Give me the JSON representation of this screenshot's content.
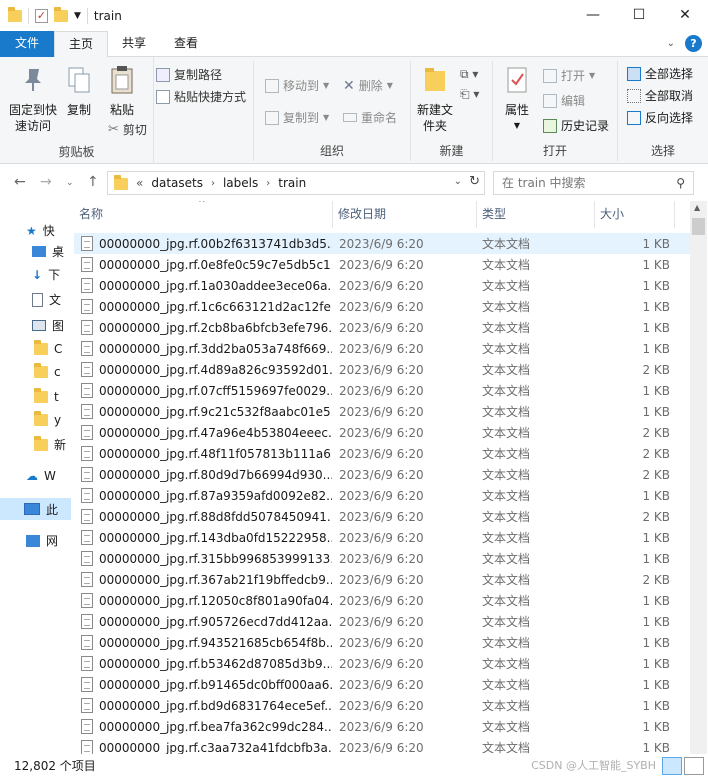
{
  "window": {
    "title": "train",
    "controls": {
      "minimize": "—",
      "maximize": "☐",
      "close": "✕"
    }
  },
  "tabs": [
    {
      "label": "文件"
    },
    {
      "label": "主页"
    },
    {
      "label": "共享"
    },
    {
      "label": "查看"
    }
  ],
  "ribbon": {
    "clipboard": {
      "label": "剪贴板",
      "pin": "固定到快速访问",
      "copy": "复制",
      "paste": "粘贴",
      "copy_path": "复制路径",
      "paste_shortcut": "粘贴快捷方式",
      "cut": "剪切"
    },
    "organize": {
      "label": "组织",
      "move_to": "移动到",
      "copy_to": "复制到",
      "delete": "删除",
      "rename": "重命名"
    },
    "new": {
      "label": "新建",
      "new_folder": "新建文件夹"
    },
    "open": {
      "label": "打开",
      "properties": "属性",
      "open": "打开",
      "edit": "编辑",
      "history": "历史记录"
    },
    "select": {
      "label": "选择",
      "select_all": "全部选择",
      "select_none": "全部取消",
      "invert": "反向选择"
    }
  },
  "address": {
    "prefix": "«",
    "crumbs": [
      "datasets",
      "labels",
      "train"
    ],
    "search_placeholder": "在 train 中搜索"
  },
  "nav": [
    {
      "label": "快",
      "icon": "star-icon",
      "color": "#1979ca"
    },
    {
      "label": "桌",
      "icon": "desktop-icon",
      "color": "#3a86d8"
    },
    {
      "label": "下",
      "icon": "download-icon",
      "color": "#1979ca"
    },
    {
      "label": "文",
      "icon": "document-icon",
      "color": "#6b7a8c"
    },
    {
      "label": "图",
      "icon": "picture-icon",
      "color": "#4a6a8a"
    },
    {
      "label": "C",
      "icon": "folder-icon",
      "color": "#f7cf5a"
    },
    {
      "label": "c",
      "icon": "folder-icon",
      "color": "#f7cf5a"
    },
    {
      "label": "t",
      "icon": "folder-icon",
      "color": "#f7cf5a"
    },
    {
      "label": "y",
      "icon": "folder-icon",
      "color": "#f7cf5a"
    },
    {
      "label": "新",
      "icon": "folder-icon",
      "color": "#f7cf5a"
    },
    {
      "label": "W",
      "icon": "cloud-icon",
      "color": "#1979ca"
    },
    {
      "label": "此",
      "icon": "computer-icon",
      "color": "#3a86d8"
    },
    {
      "label": "网",
      "icon": "network-icon",
      "color": "#3a86d8"
    }
  ],
  "columns": {
    "name": "名称",
    "date": "修改日期",
    "type": "类型",
    "size": "大小"
  },
  "files": [
    {
      "name": "00000000_jpg.rf.00b2f6313741db3d5...",
      "date": "2023/6/9 6:20",
      "type": "文本文档",
      "size": "1 KB"
    },
    {
      "name": "00000000_jpg.rf.0e8fe0c59c7e5db5c1...",
      "date": "2023/6/9 6:20",
      "type": "文本文档",
      "size": "1 KB"
    },
    {
      "name": "00000000_jpg.rf.1a030addee3ece06a...",
      "date": "2023/6/9 6:20",
      "type": "文本文档",
      "size": "1 KB"
    },
    {
      "name": "00000000_jpg.rf.1c6c663121d2ac12fe...",
      "date": "2023/6/9 6:20",
      "type": "文本文档",
      "size": "1 KB"
    },
    {
      "name": "00000000_jpg.rf.2cb8ba6bfcb3efe796...",
      "date": "2023/6/9 6:20",
      "type": "文本文档",
      "size": "1 KB"
    },
    {
      "name": "00000000_jpg.rf.3dd2ba053a748f669...",
      "date": "2023/6/9 6:20",
      "type": "文本文档",
      "size": "1 KB"
    },
    {
      "name": "00000000_jpg.rf.4d89a826c93592d01...",
      "date": "2023/6/9 6:20",
      "type": "文本文档",
      "size": "2 KB"
    },
    {
      "name": "00000000_jpg.rf.07cff5159697fe0029...",
      "date": "2023/6/9 6:20",
      "type": "文本文档",
      "size": "1 KB"
    },
    {
      "name": "00000000_jpg.rf.9c21c532f8aabc01e5...",
      "date": "2023/6/9 6:20",
      "type": "文本文档",
      "size": "1 KB"
    },
    {
      "name": "00000000_jpg.rf.47a96e4b53804eeec...",
      "date": "2023/6/9 6:20",
      "type": "文本文档",
      "size": "2 KB"
    },
    {
      "name": "00000000_jpg.rf.48f11f057813b111a6...",
      "date": "2023/6/9 6:20",
      "type": "文本文档",
      "size": "2 KB"
    },
    {
      "name": "00000000_jpg.rf.80d9d7b66994d930...",
      "date": "2023/6/9 6:20",
      "type": "文本文档",
      "size": "2 KB"
    },
    {
      "name": "00000000_jpg.rf.87a9359afd0092e82...",
      "date": "2023/6/9 6:20",
      "type": "文本文档",
      "size": "1 KB"
    },
    {
      "name": "00000000_jpg.rf.88d8fdd5078450941...",
      "date": "2023/6/9 6:20",
      "type": "文本文档",
      "size": "2 KB"
    },
    {
      "name": "00000000_jpg.rf.143dba0fd15222958...",
      "date": "2023/6/9 6:20",
      "type": "文本文档",
      "size": "1 KB"
    },
    {
      "name": "00000000_jpg.rf.315bb996853999133...",
      "date": "2023/6/9 6:20",
      "type": "文本文档",
      "size": "1 KB"
    },
    {
      "name": "00000000_jpg.rf.367ab21f19bffedcb9...",
      "date": "2023/6/9 6:20",
      "type": "文本文档",
      "size": "2 KB"
    },
    {
      "name": "00000000_jpg.rf.12050c8f801a90fa04...",
      "date": "2023/6/9 6:20",
      "type": "文本文档",
      "size": "1 KB"
    },
    {
      "name": "00000000_jpg.rf.905726ecd7dd412aa...",
      "date": "2023/6/9 6:20",
      "type": "文本文档",
      "size": "1 KB"
    },
    {
      "name": "00000000_jpg.rf.943521685cb654f8b...",
      "date": "2023/6/9 6:20",
      "type": "文本文档",
      "size": "1 KB"
    },
    {
      "name": "00000000_jpg.rf.b53462d87085d3b9...",
      "date": "2023/6/9 6:20",
      "type": "文本文档",
      "size": "1 KB"
    },
    {
      "name": "00000000_jpg.rf.b91465dc0bff000aa6...",
      "date": "2023/6/9 6:20",
      "type": "文本文档",
      "size": "1 KB"
    },
    {
      "name": "00000000_jpg.rf.bd9d6831764ece5ef...",
      "date": "2023/6/9 6:20",
      "type": "文本文档",
      "size": "1 KB"
    },
    {
      "name": "00000000_jpg.rf.bea7fa362c99dc284...",
      "date": "2023/6/9 6:20",
      "type": "文本文档",
      "size": "1 KB"
    },
    {
      "name": "00000000_jpg.rf.c3aa732a41fdcbfb3a...",
      "date": "2023/6/9 6:20",
      "type": "文本文档",
      "size": "1 KB"
    }
  ],
  "status": {
    "count": "12,802 个项目",
    "watermark": "CSDN @人工智能_SYBH"
  }
}
